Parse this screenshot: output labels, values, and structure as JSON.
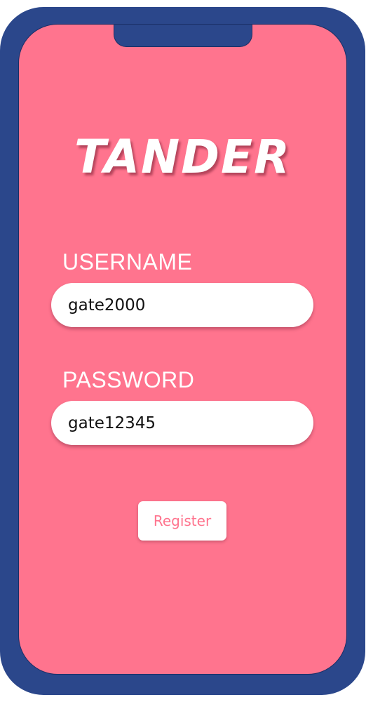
{
  "app": {
    "logo_text": "TANDER"
  },
  "form": {
    "username_label": "USERNAME",
    "username_value": "gate2000",
    "password_label": "PASSWORD",
    "password_value": "gate12345",
    "register_label": "Register"
  },
  "colors": {
    "phone_frame": "#2b478b",
    "screen_background": "#ff748e",
    "input_background": "#ffffff",
    "button_text": "#ff748e"
  }
}
